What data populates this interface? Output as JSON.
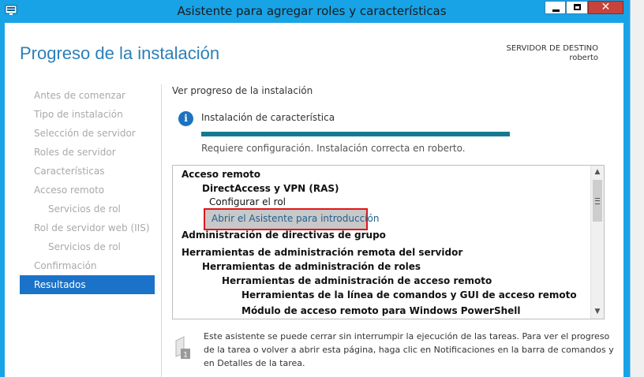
{
  "window": {
    "title": "Asistente para agregar roles y características",
    "minimize_icon": "minimize-icon",
    "maximize_icon": "maximize-icon",
    "close_glyph": "✕"
  },
  "page": {
    "heading": "Progreso de la instalación",
    "destination_label": "SERVIDOR DE DESTINO",
    "destination_server": "roberto"
  },
  "nav": {
    "items": [
      {
        "label": "Antes de comenzar"
      },
      {
        "label": "Tipo de instalación"
      },
      {
        "label": "Selección de servidor"
      },
      {
        "label": "Roles de servidor"
      },
      {
        "label": "Características"
      },
      {
        "label": "Acceso remoto"
      },
      {
        "label": "Servicios de rol"
      },
      {
        "label": "Rol de servidor web (IIS)"
      },
      {
        "label": "Servicios de rol"
      },
      {
        "label": "Confirmación"
      },
      {
        "label": "Resultados"
      }
    ]
  },
  "main": {
    "section_title": "Ver progreso de la instalación",
    "info_glyph": "i",
    "feature_label": "Instalación de característica",
    "progress_percent": 100,
    "status_text": "Requiere configuración. Instalación correcta en roberto.",
    "tree": [
      "Acceso remoto",
      "DirectAccess y VPN (RAS)",
      "Configurar el rol",
      "Abrir el Asistente para introducción",
      "Administración de directivas de grupo",
      "Herramientas de administración remota del servidor",
      "Herramientas de administración de roles",
      "Herramientas de administración de acceso remoto",
      "Herramientas de la línea de comandos y GUI de acceso remoto",
      "Módulo de acceso remoto para Windows PowerShell"
    ],
    "scroll_up": "▲",
    "scroll_down": "▼",
    "note_text": "Este asistente se puede cerrar sin interrumpir la ejecución de las tareas. Para ver el progreso de la tarea o volver a abrir esta página, haga clic en Notificaciones en la barra de comandos y en Detalles de la tarea.",
    "note_badge": "1"
  },
  "colors": {
    "titlebar": "#18a3e6",
    "heading": "#2b7fb8",
    "nav_active": "#1a73c8",
    "progress_fill": "#157a8f",
    "highlight_border": "#e0161a"
  }
}
